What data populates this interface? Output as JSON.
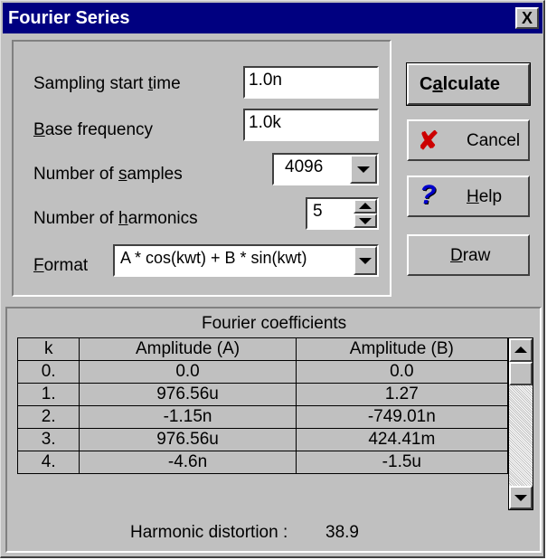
{
  "window": {
    "title": "Fourier Series",
    "close_label": "X"
  },
  "settings": {
    "sampling_start_time": {
      "label_pre": "Sampling start ",
      "label_key": "t",
      "label_post": "ime",
      "value": "1.0n"
    },
    "base_frequency": {
      "label_pre": "",
      "label_key": "B",
      "label_post": "ase frequency",
      "value": "1.0k"
    },
    "number_of_samples": {
      "label_pre": "Number of ",
      "label_key": "s",
      "label_post": "amples",
      "value": "4096"
    },
    "number_of_harmonics": {
      "label_pre": "Number of ",
      "label_key": "h",
      "label_post": "armonics",
      "value": "5"
    },
    "format": {
      "label_pre": "",
      "label_key": "F",
      "label_post": "ormat",
      "value": "A * cos(kwt) + B * sin(kwt)"
    }
  },
  "buttons": {
    "calculate": {
      "pre": "C",
      "key": "a",
      "post": "lculate"
    },
    "cancel": {
      "label": "Cancel"
    },
    "help": {
      "pre": "",
      "key": "H",
      "post": "elp"
    },
    "draw": {
      "pre": "",
      "key": "D",
      "post": "raw"
    }
  },
  "results": {
    "header": "Fourier coefficients",
    "columns": [
      "k",
      "Amplitude (A)",
      "Amplitude (B)"
    ],
    "rows": [
      [
        "0.",
        "0.0",
        "0.0"
      ],
      [
        "1.",
        "976.56u",
        "1.27"
      ],
      [
        "2.",
        "-1.15n",
        "-749.01n"
      ],
      [
        "3.",
        "976.56u",
        "424.41m"
      ],
      [
        "4.",
        "-4.6n",
        "-1.5u"
      ]
    ],
    "distortion_label": "Harmonic distortion :",
    "distortion_value": "38.9"
  },
  "icons": {
    "cancel": "x-icon",
    "help": "question-mark-icon"
  },
  "colors": {
    "titlebar": "#000080",
    "cancel_x": "#cc0000",
    "help_q": "#0000cc"
  }
}
